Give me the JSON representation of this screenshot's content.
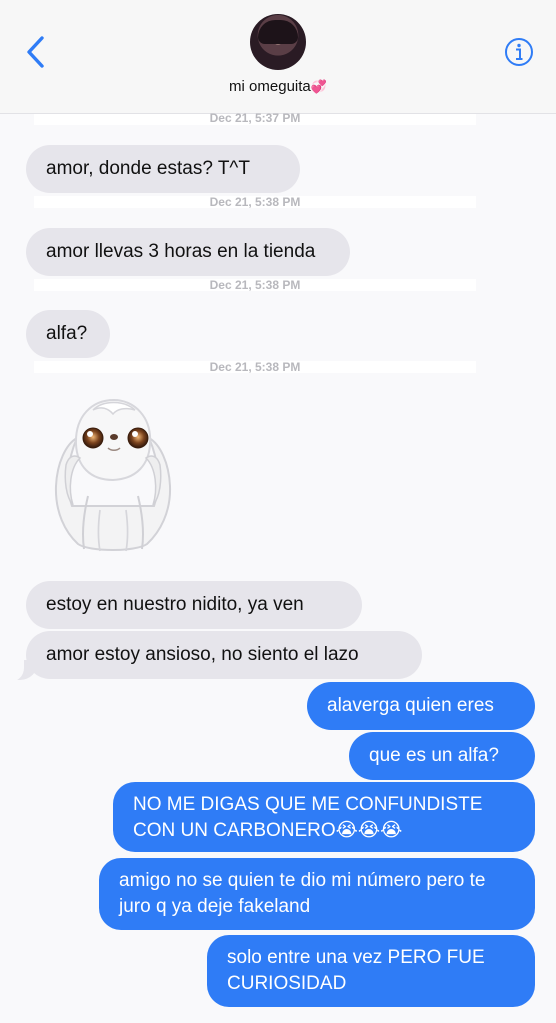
{
  "header": {
    "contact_name": "mi omeguita",
    "emoji": "💞"
  },
  "timestamps": [
    "Dec 21, 5:37 PM",
    "Dec 21, 5:38 PM",
    "Dec 21, 5:38 PM",
    "Dec 21, 5:38 PM"
  ],
  "messages": [
    {
      "direction": "incoming",
      "text": "amor, donde estas? T^T"
    },
    {
      "direction": "incoming",
      "text": "amor llevas 3 horas en la tienda"
    },
    {
      "direction": "incoming",
      "text": "alfa?"
    },
    {
      "direction": "incoming",
      "type": "sticker",
      "icon": "fluffy-dog-sticker"
    },
    {
      "direction": "incoming",
      "text": "estoy en nuestro nidito, ya ven"
    },
    {
      "direction": "incoming",
      "text": "amor estoy ansioso, no siento el lazo"
    },
    {
      "direction": "outgoing",
      "text": "alaverga quien eres"
    },
    {
      "direction": "outgoing",
      "text": "que es un alfa?"
    },
    {
      "direction": "outgoing",
      "text": "NO ME DIGAS QUE ME CONFUNDISTE CON UN CARBONERO😭😭😭"
    },
    {
      "direction": "outgoing",
      "text": "amigo no se quien te dio mi número pero te juro q ya deje fakeland"
    },
    {
      "direction": "outgoing",
      "text": "solo entre una vez PERO FUE CURIOSIDAD"
    }
  ],
  "colors": {
    "accent": "#2f7cf6",
    "incoming_bubble": "#e6e5eb",
    "outgoing_bubble": "#2f7cf6"
  }
}
